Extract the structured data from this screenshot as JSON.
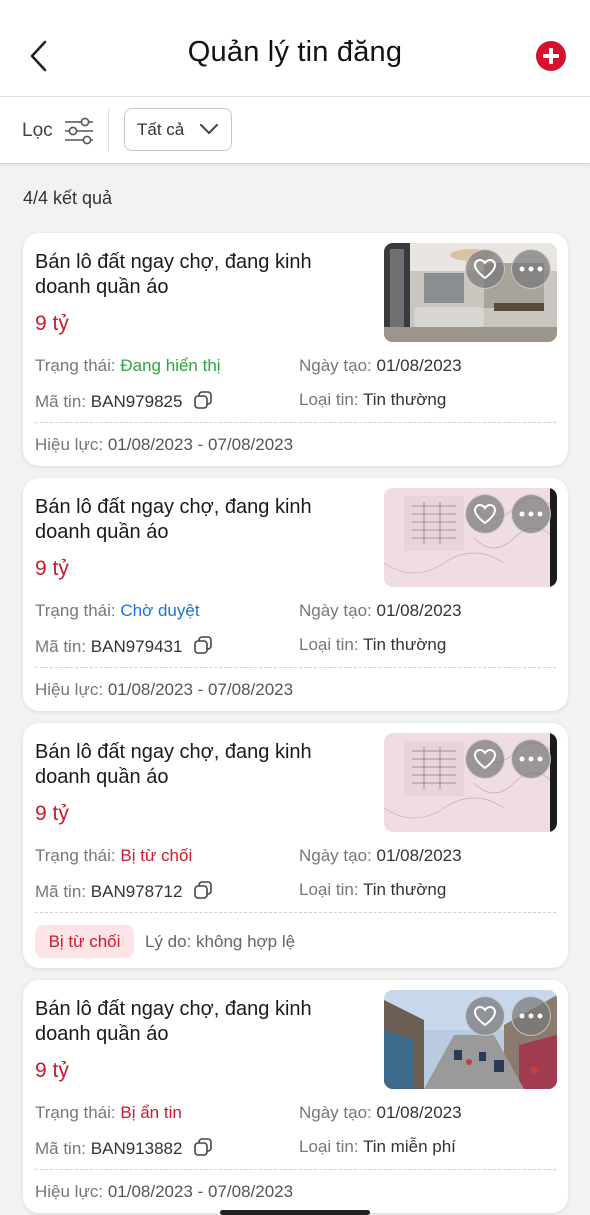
{
  "header": {
    "title": "Quản lý tin đăng"
  },
  "filterbar": {
    "filter_label": "Lọc",
    "status_value": "Tất cả"
  },
  "result_count": "4/4 kết quả",
  "colors": {
    "brand": "#d7102b",
    "price": "#cc1a2f",
    "status_shown": "#2fa33e",
    "status_pending": "#1a73d9",
    "status_rejected": "#cc1a2f"
  },
  "listings": [
    {
      "title": "Bán lô đất ngay chợ, đang kinh doanh quần áo",
      "price": "9 tỷ",
      "status_label": "Trạng thái:",
      "status_value": "Đang hiển thị",
      "created_label": "Ngày tạo:",
      "created_value": "01/08/2023",
      "code_label": "Mã tin:",
      "code_value": "BAN979825",
      "type_label": "Loại tin:",
      "type_value": "Tin thường",
      "validity_label": "Hiệu lực:",
      "validity_value": "01/08/2023 - 07/08/2023",
      "thumbnail": "living-room-photo"
    },
    {
      "title": "Bán lô đất ngay chợ, đang kinh doanh quần áo",
      "price": "9 tỷ",
      "status_label": "Trạng thái:",
      "status_value": "Chờ duyệt",
      "created_label": "Ngày tạo:",
      "created_value": "01/08/2023",
      "code_label": "Mã tin:",
      "code_value": "BAN979431",
      "type_label": "Loại tin:",
      "type_value": "Tin thường",
      "validity_label": "Hiệu lực:",
      "validity_value": "01/08/2023 - 07/08/2023",
      "thumbnail": "land-certificate-photo"
    },
    {
      "title": "Bán lô đất ngay chợ, đang kinh doanh quần áo",
      "price": "9 tỷ",
      "status_label": "Trạng thái:",
      "status_value": "Bị từ chối",
      "created_label": "Ngày tạo:",
      "created_value": "01/08/2023",
      "code_label": "Mã tin:",
      "code_value": "BAN978712",
      "type_label": "Loại tin:",
      "type_value": "Tin thường",
      "reject_badge": "Bị từ chối",
      "reject_reason": "Lý do: không hợp lệ",
      "thumbnail": "land-certificate-photo"
    },
    {
      "title": "Bán lô đất ngay chợ, đang kinh doanh quần áo",
      "price": "9 tỷ",
      "status_label": "Trạng thái:",
      "status_value": "Bị ẩn tin",
      "created_label": "Ngày tạo:",
      "created_value": "01/08/2023",
      "code_label": "Mã tin:",
      "code_value": "BAN913882",
      "type_label": "Loại tin:",
      "type_value": "Tin miễn phí",
      "validity_label": "Hiệu lực:",
      "validity_value": "01/08/2023 - 07/08/2023",
      "thumbnail": "street-market-photo"
    }
  ]
}
